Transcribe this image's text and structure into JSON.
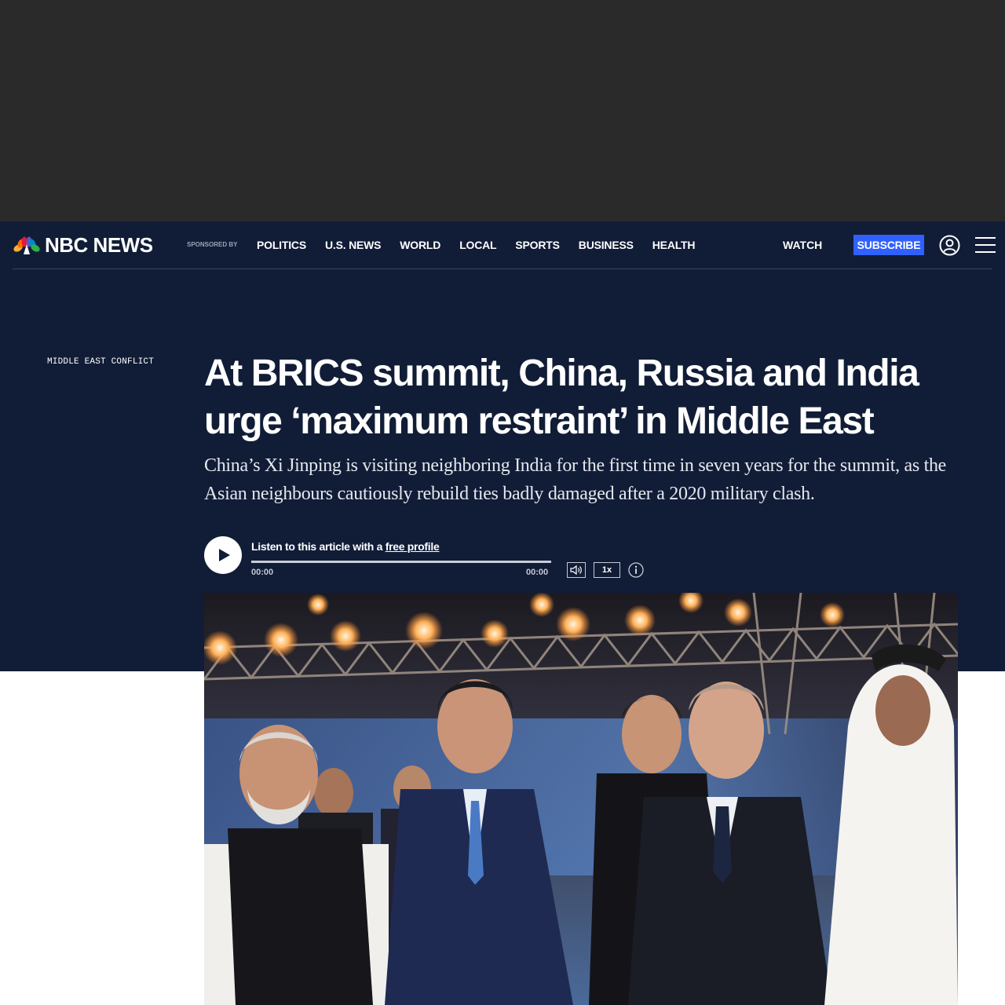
{
  "brand": {
    "name": "NBC NEWS",
    "sponsored_label": "SPONSORED BY"
  },
  "nav": {
    "items": [
      "POLITICS",
      "U.S. NEWS",
      "WORLD",
      "LOCAL",
      "SPORTS",
      "BUSINESS",
      "HEALTH"
    ],
    "watch": "WATCH",
    "subscribe": "SUBSCRIBE",
    "account_icon": "account-icon",
    "menu_icon": "hamburger-menu-icon"
  },
  "article": {
    "eyebrow": "MIDDLE EAST CONFLICT",
    "headline": "At BRICS summit, China, Russia and India urge ‘maximum restraint’ in Middle East",
    "dek": "China’s Xi Jinping is visiting neighboring India for the first time in seven years for the summit, as the Asian neighbours cautiously rebuild ties badly damaged after a 2020 military clash."
  },
  "audio": {
    "listen_prefix": "Listen to this article with a ",
    "listen_link": "free profile",
    "time_current": "00:00",
    "time_total": "00:00",
    "speed": "1x",
    "progress": 0
  },
  "colors": {
    "ad_background": "#2a2a2a",
    "header_background": "#111d37",
    "subscribe_accent": "#3061ff"
  }
}
